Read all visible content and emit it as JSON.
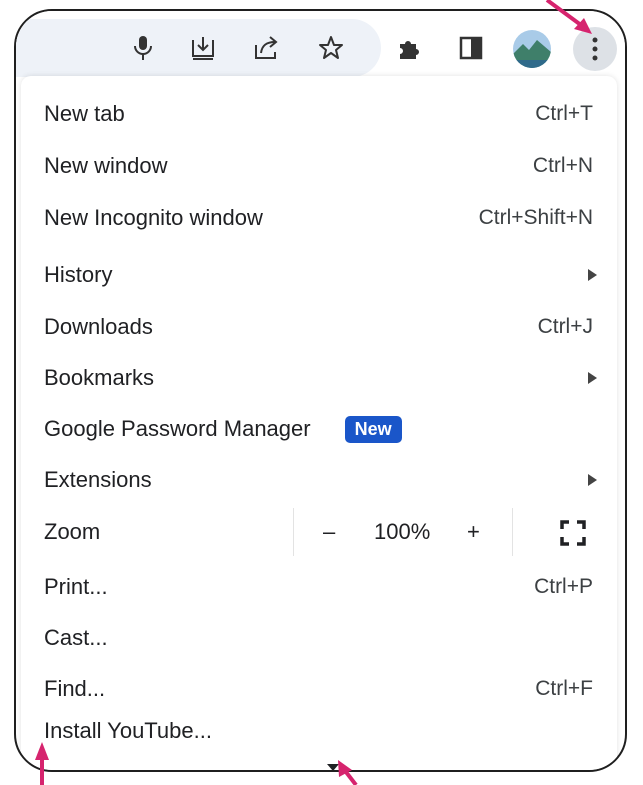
{
  "toolbar": {
    "icons": [
      "microphone-icon",
      "install-app-icon",
      "share-icon",
      "bookmark-star-icon",
      "extensions-icon",
      "side-panel-icon",
      "profile-avatar",
      "more-options-icon"
    ]
  },
  "menu": {
    "new_tab": {
      "label": "New tab",
      "shortcut": "Ctrl+T"
    },
    "new_window": {
      "label": "New window",
      "shortcut": "Ctrl+N"
    },
    "new_incognito": {
      "label": "New Incognito window",
      "shortcut": "Ctrl+Shift+N"
    },
    "history": {
      "label": "History"
    },
    "downloads": {
      "label": "Downloads",
      "shortcut": "Ctrl+J"
    },
    "bookmarks": {
      "label": "Bookmarks"
    },
    "password_manager": {
      "label": "Google Password Manager",
      "badge": "New"
    },
    "extensions": {
      "label": "Extensions"
    },
    "zoom": {
      "label": "Zoom",
      "minus": "–",
      "value": "100%",
      "plus": "+"
    },
    "print": {
      "label": "Print...",
      "shortcut": "Ctrl+P"
    },
    "cast": {
      "label": "Cast..."
    },
    "find": {
      "label": "Find...",
      "shortcut": "Ctrl+F"
    },
    "install": {
      "label": "Install YouTube..."
    }
  },
  "colors": {
    "annotation_arrow": "#d6246e",
    "badge": "#1a56c9",
    "omnibox": "#eef2f8"
  }
}
